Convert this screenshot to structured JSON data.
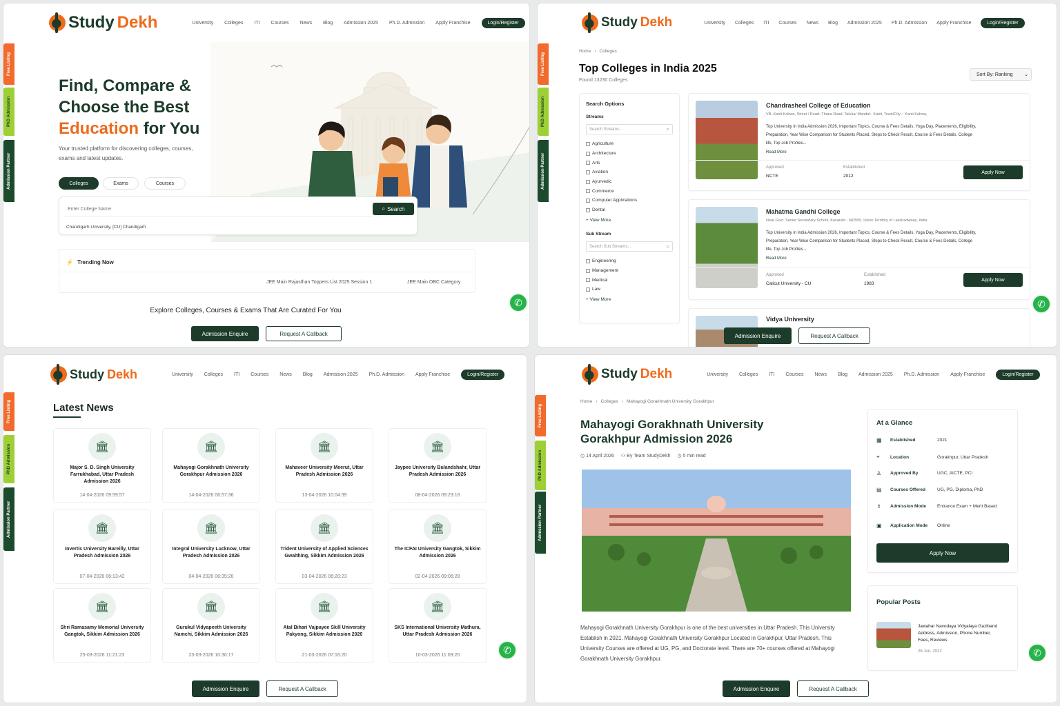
{
  "brand": {
    "study": "Study",
    "dekh": "Dekh"
  },
  "nav": {
    "items": [
      "University",
      "Colleges",
      "ITI",
      "Courses",
      "News",
      "Blog",
      "Admission 2025",
      "Ph.D. Admission",
      "Apply Franchise"
    ],
    "login": "Login/Register"
  },
  "side_tabs": {
    "free": "Free Listing",
    "phd": "PhD Admission",
    "partner": "Admission Partner"
  },
  "bottom": {
    "enquire": "Admission Enquire",
    "callback": "Request A Callback"
  },
  "home": {
    "title_1": "Find, Compare &",
    "title_2": "Choose the Best",
    "title_3": "Education",
    "title_4": "for You",
    "subtitle": "Your trusted platform for discovering colleges, courses, exams and latest updates.",
    "tabs": [
      "Colleges",
      "Exams",
      "Courses"
    ],
    "search_placeholder": "Enter College Name",
    "search_button": "Search",
    "suggestion": "Chandigarh University, [CU] Chandigarh",
    "trending_label": "Trending Now",
    "trending_items": [
      "JEE Main Rajasthan Toppers List 2025 Session 1",
      "JEE Main OBC Category"
    ],
    "explore": "Explore Colleges, Courses & Exams That Are Curated For You"
  },
  "listing": {
    "breadcrumb": [
      "Home",
      "Colleges"
    ],
    "title": "Top Colleges in India 2025",
    "found": "Found 13230 Colleges",
    "sort": "Sort By: Ranking",
    "filters_title": "Search Options",
    "streams_label": "Streams",
    "streams_placeholder": "Search Streams...",
    "streams": [
      "Agriculture",
      "Architecture",
      "Arts",
      "Aviation",
      "Ayurvedic",
      "Commerce",
      "Computer Applications",
      "Dental"
    ],
    "view_more": "+ View More",
    "sub_stream_label": "Sub Stream",
    "sub_stream_placeholder": "Search Sub Streams...",
    "sub_streams": [
      "Engineering",
      "Management",
      "Medical",
      "Law"
    ],
    "colleges": [
      {
        "name": "Chandrasheel College of Education",
        "address": "Vill.-Kanti Kahwa, Street / Road:-Thana Road, Taluka/ Mandal:- Kanti, Town/City :- Kanti Kahwa,",
        "desc": "Top University in India Admission 2026, Important Topics, Course & Fees Details, Yoga Day, Placements, Eligibility, Preparation, Year Wise Comparison for Students Placed, Steps to Check Result, Course & Fees Details, College life, Top Job Profiles...",
        "read_more": "Read More",
        "approved_label": "Approved",
        "approved": "NCTE",
        "established_label": "Established",
        "established": "2012",
        "apply": "Apply Now"
      },
      {
        "name": "Mahatma Gandhi College",
        "address": "Near Govt. Senior Secondary School, Kavaratti - 682555, Union Territory of Lakshadweep, India",
        "desc": "Top University in India Admission 2026, Important Topics, Course & Fees Details, Yoga Day, Placements, Eligibility, Preparation, Year Wise Comparison for Students Placed, Steps to Check Result, Course & Fees Details, College life, Top Job Profiles...",
        "read_more": "Read More",
        "approved_label": "Approved",
        "approved": "Calicut University - CU",
        "established_label": "Established",
        "established": "1983",
        "apply": "Apply Now"
      },
      {
        "name": "Vidya University"
      }
    ]
  },
  "news": {
    "title": "Latest News",
    "items": [
      {
        "title": "Major S. D. Singh University Farrukhabad, Uttar Pradesh Admission 2026",
        "date": "14-04-2026 09:59:57"
      },
      {
        "title": "Mahayogi Gorakhnath University Gorakhpur Admission 2026",
        "date": "14-04-2026 06:57:36"
      },
      {
        "title": "Mahaveer University Meerut, Uttar Pradesh Admission 2026",
        "date": "13-04-2026 10:04:39"
      },
      {
        "title": "Jaypee University Bulandshahr, Uttar Pradesh Admission 2026",
        "date": "08-04-2026 09:23:16"
      },
      {
        "title": "Invertis University Bareilly, Uttar Pradesh Admission 2026",
        "date": "07-04-2026 06:13:42"
      },
      {
        "title": "Integral University Lucknow, Uttar Pradesh Admission 2026",
        "date": "04-04-2026 06:35:20"
      },
      {
        "title": "Trident University of Applied Sciences Gwalthing, Sikkim Admission 2026",
        "date": "03-04-2026 06:20:23"
      },
      {
        "title": "The ICFAI University Gangtok, Sikkim Admission 2026",
        "date": "02-04-2026 09:06:28"
      },
      {
        "title": "Shri Ramasamy Memorial University Gangtok, Sikkim Admission 2026",
        "date": "25-03-2026 11:21:23"
      },
      {
        "title": "Gurukul Vidyapeeth University Namchi, Sikkim Admission 2026",
        "date": "23-03-2026 10:30:17"
      },
      {
        "title": "Atal Bihari Vajpayee Skill University Pakyong, Sikkim Admission 2026",
        "date": "21-03-2026 07:16:20"
      },
      {
        "title": "SKS International University Mathura, Uttar Pradesh Admission 2026",
        "date": "10-03-2026 11:09:20"
      }
    ]
  },
  "article": {
    "breadcrumb": [
      "Home",
      "Colleges",
      "Mahayogi Gorakhnath University Gorakhpur"
    ],
    "title_1": "Mahayogi Gorakhnath University",
    "title_2": "Gorakhpur Admission 2026",
    "date": "14 April 2026",
    "author": "By Team StudyDekh",
    "read_time": "5 min read",
    "body": "Mahayogi Gorakhnath University Gorakhpur is one of the best universities in Uttar Pradesh. This University Establish in 2021. Mahayogi Gorakhnath University Gorakhpur Located in Gorakhpur, Uttar Pradesh. This University Courses are offered at UG, PG, and Doctorate level. There are 70+ courses offered at Mahayogi Gorakhnath University Gorakhpur.",
    "glance_title": "At a Glance",
    "glance": [
      {
        "key": "Established",
        "value": "2021",
        "icon": "calendar-icon"
      },
      {
        "key": "Location",
        "value": "Gorakhpur, Uttar Pradesh",
        "icon": "location-icon"
      },
      {
        "key": "Approved By",
        "value": "UGC, AICTE, PCI",
        "icon": "user-check-icon"
      },
      {
        "key": "Courses Offered",
        "value": "UG, PG, Diploma, PhD",
        "icon": "book-icon"
      },
      {
        "key": "Admission Mode",
        "value": "Entrance Exam + Merit Based",
        "icon": "admission-icon"
      },
      {
        "key": "Application Mode",
        "value": "Online",
        "icon": "application-icon"
      }
    ],
    "apply": "Apply Now",
    "popular_title": "Popular Posts",
    "popular": [
      {
        "title": "Jawahar Navodaya Vidyalaya Gaziband Address, Admission, Phone Number, Fees, Reviews",
        "date": "26 Jun, 2022"
      }
    ]
  }
}
